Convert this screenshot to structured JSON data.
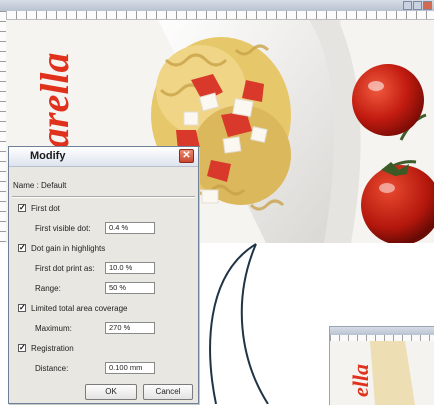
{
  "dialog": {
    "title": "Modify",
    "close_label": "✕",
    "name_label": "Name : Default",
    "first_dot": {
      "checkbox_label": "First dot",
      "checked": true,
      "visible_dot_label": "First visible dot:",
      "visible_dot_value": "0.4 %"
    },
    "dot_gain": {
      "checkbox_label": "Dot gain in highlights",
      "checked": true,
      "print_as_label": "First dot print as:",
      "print_as_value": "10.0 %",
      "range_label": "Range:",
      "range_value": "50 %"
    },
    "limited_coverage": {
      "checkbox_label": "Limited total area coverage",
      "checked": true,
      "maximum_label": "Maximum:",
      "maximum_value": "270 %"
    },
    "registration": {
      "checkbox_label": "Registration",
      "checked": true,
      "distance_label": "Distance:",
      "distance_value": "0.100 mm"
    },
    "ok_label": "OK",
    "cancel_label": "Cancel"
  },
  "photo": {
    "brand_text": "arella",
    "mini_brand_text": "ella"
  },
  "colors": {
    "dialog_bg": "#e9e7e2",
    "brand_red": "#e0311d",
    "connector": "#1f3547"
  }
}
